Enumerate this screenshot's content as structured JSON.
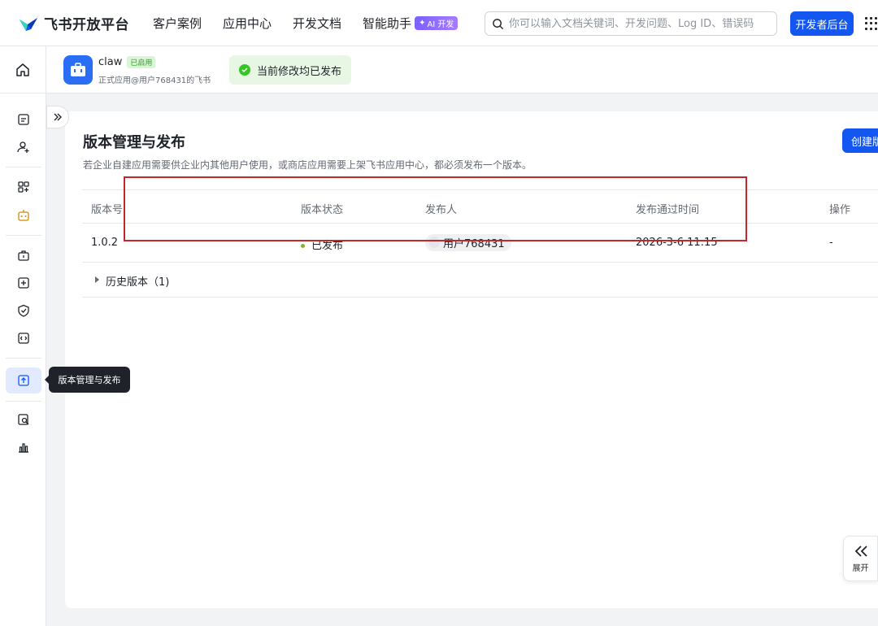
{
  "header": {
    "logo_text": "飞书开放平台",
    "nav": [
      {
        "label": "客户案例"
      },
      {
        "label": "应用中心"
      },
      {
        "label": "开发文档"
      },
      {
        "label": "智能助手",
        "badge": "AI 开发"
      }
    ],
    "search_placeholder": "你可以输入文档关键词、开发问题、Log ID、错误码",
    "dev_console_label": "开发者后台"
  },
  "app": {
    "name": "claw",
    "status_tag": "已启用",
    "subtitle": "正式应用@用户768431的飞书",
    "publish_status": "当前修改均已发布"
  },
  "sidebar": {
    "tooltip": "版本管理与发布",
    "icons": [
      "credentials-icon",
      "add-member-icon",
      "add-feature-icon",
      "bot-icon",
      "app-capability-icon",
      "event-subscribe-icon",
      "security-icon",
      "dev-config-icon",
      "version-publish-icon",
      "log-search-icon",
      "analytics-icon"
    ]
  },
  "main": {
    "title": "版本管理与发布",
    "description": "若企业自建应用需要供企业内其他用户使用，或商店应用需要上架飞书应用中心，都必须发布一个版本。",
    "create_button": "创建版本",
    "table": {
      "columns": [
        "版本号",
        "版本状态",
        "发布人",
        "发布通过时间",
        "操作"
      ],
      "rows": [
        {
          "version": "1.0.2",
          "status": "已发布",
          "publisher": "用户768431",
          "time": "2026-3-6 11:15",
          "action": "-"
        }
      ]
    },
    "history_label": "历史版本（1)"
  },
  "expand_label": "展开",
  "colors": {
    "accent": "#1456f0",
    "success": "#34c724",
    "highlight": "#c0282a"
  }
}
